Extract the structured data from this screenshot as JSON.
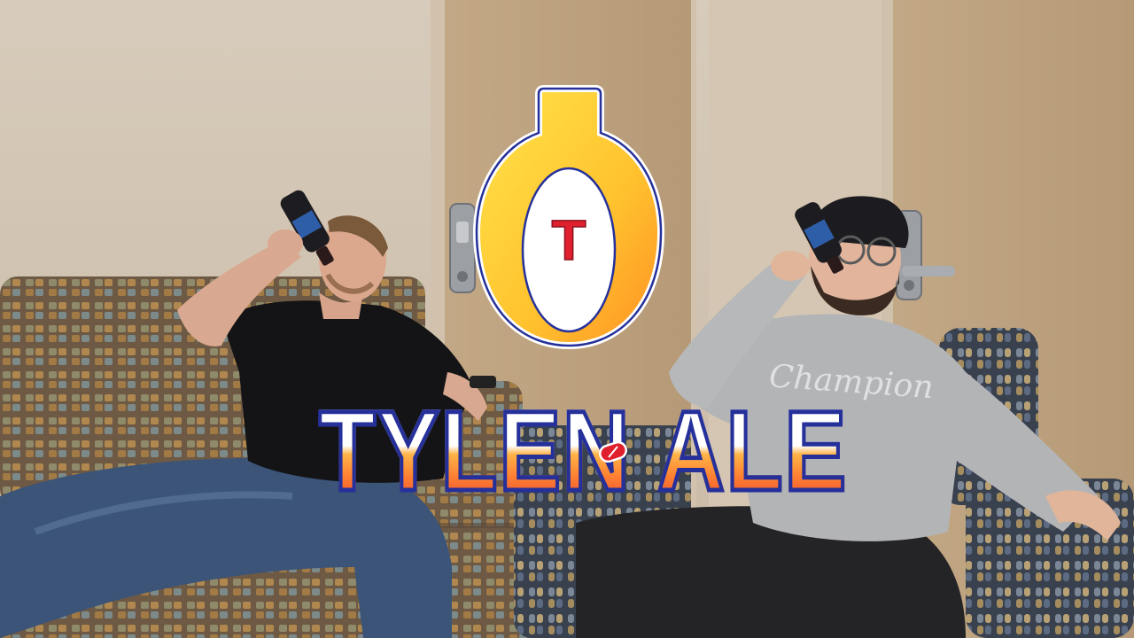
{
  "logo": {
    "badge_letter": "T"
  },
  "title": {
    "left": "TYLEN",
    "right": "ALE"
  },
  "colors": {
    "gold": "#ffd233",
    "orange": "#ff8a2b",
    "red": "#e1202e",
    "navy": "#25309a"
  }
}
